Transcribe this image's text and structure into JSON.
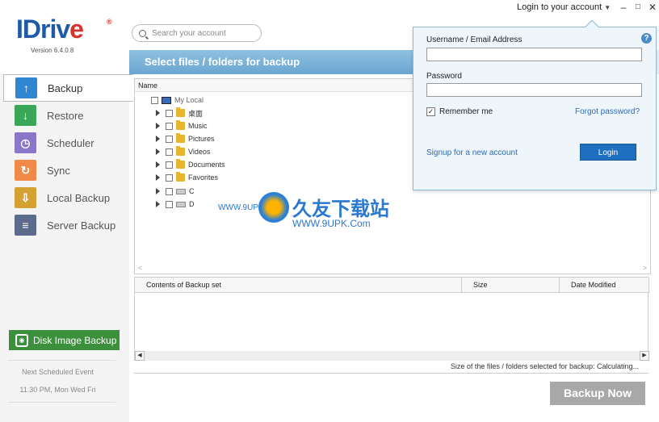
{
  "window": {
    "login_toggle": "Login to your account",
    "minimize": "–",
    "restore": "□",
    "close": "✕"
  },
  "logo": {
    "text_i": "IDriv",
    "text_e": "e",
    "reg": "®",
    "version": "Version  6.4.0.8"
  },
  "sidebar": {
    "items": [
      {
        "label": "Backup",
        "icon": "upload-arrow-icon",
        "color": "#2f86d1",
        "glyph": "↑"
      },
      {
        "label": "Restore",
        "icon": "download-arrow-icon",
        "color": "#3aa657",
        "glyph": "↓"
      },
      {
        "label": "Scheduler",
        "icon": "clock-icon",
        "color": "#8a77c9",
        "glyph": "◷"
      },
      {
        "label": "Sync",
        "icon": "sync-icon",
        "color": "#f08a48",
        "glyph": "↻"
      },
      {
        "label": "Local Backup",
        "icon": "local-drive-icon",
        "color": "#d4a233",
        "glyph": "⇩"
      },
      {
        "label": "Server Backup",
        "icon": "server-icon",
        "color": "#5c6a8c",
        "glyph": "≡"
      }
    ],
    "disk_image_label": "Disk Image Backup",
    "next_event_title": "Next Scheduled Event",
    "next_event_value": "11.30 PM, Mon Wed Fri"
  },
  "search": {
    "placeholder": "Search your account"
  },
  "banner": {
    "title": "Select files / folders for backup"
  },
  "tree": {
    "header": "Name",
    "root": "My Local",
    "items": [
      {
        "label": "桌面",
        "kind": "folder"
      },
      {
        "label": "Music",
        "kind": "folder"
      },
      {
        "label": "Pictures",
        "kind": "folder"
      },
      {
        "label": "Videos",
        "kind": "folder"
      },
      {
        "label": "Documents",
        "kind": "folder"
      },
      {
        "label": "Favorites",
        "kind": "folder"
      },
      {
        "label": "C",
        "kind": "drive"
      },
      {
        "label": "D",
        "kind": "drive"
      }
    ]
  },
  "contents": {
    "col_contents": "Contents of Backup set",
    "col_size": "Size",
    "col_date": "Date Modified"
  },
  "status": {
    "text": "Size of the files / folders selected for backup: Calculating..."
  },
  "backup_now": {
    "label": "Backup Now"
  },
  "watermark": {
    "big": "久友下载站",
    "small": "WWW.9UPK.Com",
    "left": "WWW.9UPK.COM"
  },
  "login": {
    "username_label": "Username / Email Address",
    "password_label": "Password",
    "remember_label": "Remember me",
    "remember_checked": true,
    "forgot": "Forgot password?",
    "signup": "Signup for a new account",
    "login_button": "Login",
    "help": "?"
  }
}
